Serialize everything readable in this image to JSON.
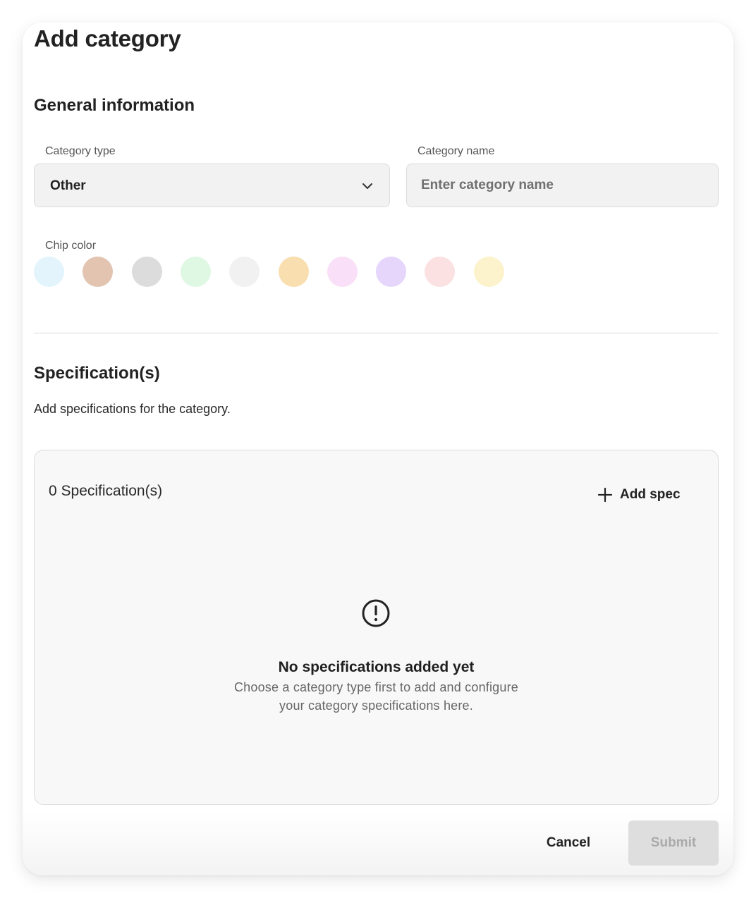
{
  "title": "Add category",
  "general": {
    "heading": "General information",
    "category_type": {
      "label": "Category type",
      "value": "Other",
      "icon": "chevron-down-icon"
    },
    "category_name": {
      "label": "Category name",
      "value": "",
      "placeholder": "Enter category name"
    },
    "chip_color": {
      "label": "Chip color",
      "colors": [
        "#e3f4fd",
        "#e2c4b1",
        "#dcdcdc",
        "#dff8e3",
        "#f1f1f1",
        "#f9dfb0",
        "#f9e0f8",
        "#e6d6fb",
        "#fbe1e1",
        "#fcf3cd"
      ]
    }
  },
  "specifications": {
    "heading": "Specification(s)",
    "description": "Add specifications for the category.",
    "count_label": "0 Specification(s)",
    "add_label": "Add spec",
    "add_icon": "plus-icon",
    "empty": {
      "icon": "exclamation-circle-icon",
      "title": "No specifications added yet",
      "description_line1": "Choose a category type first to add and configure",
      "description_line2": "your category specifications here."
    }
  },
  "footer": {
    "cancel_label": "Cancel",
    "submit_label": "Submit"
  }
}
